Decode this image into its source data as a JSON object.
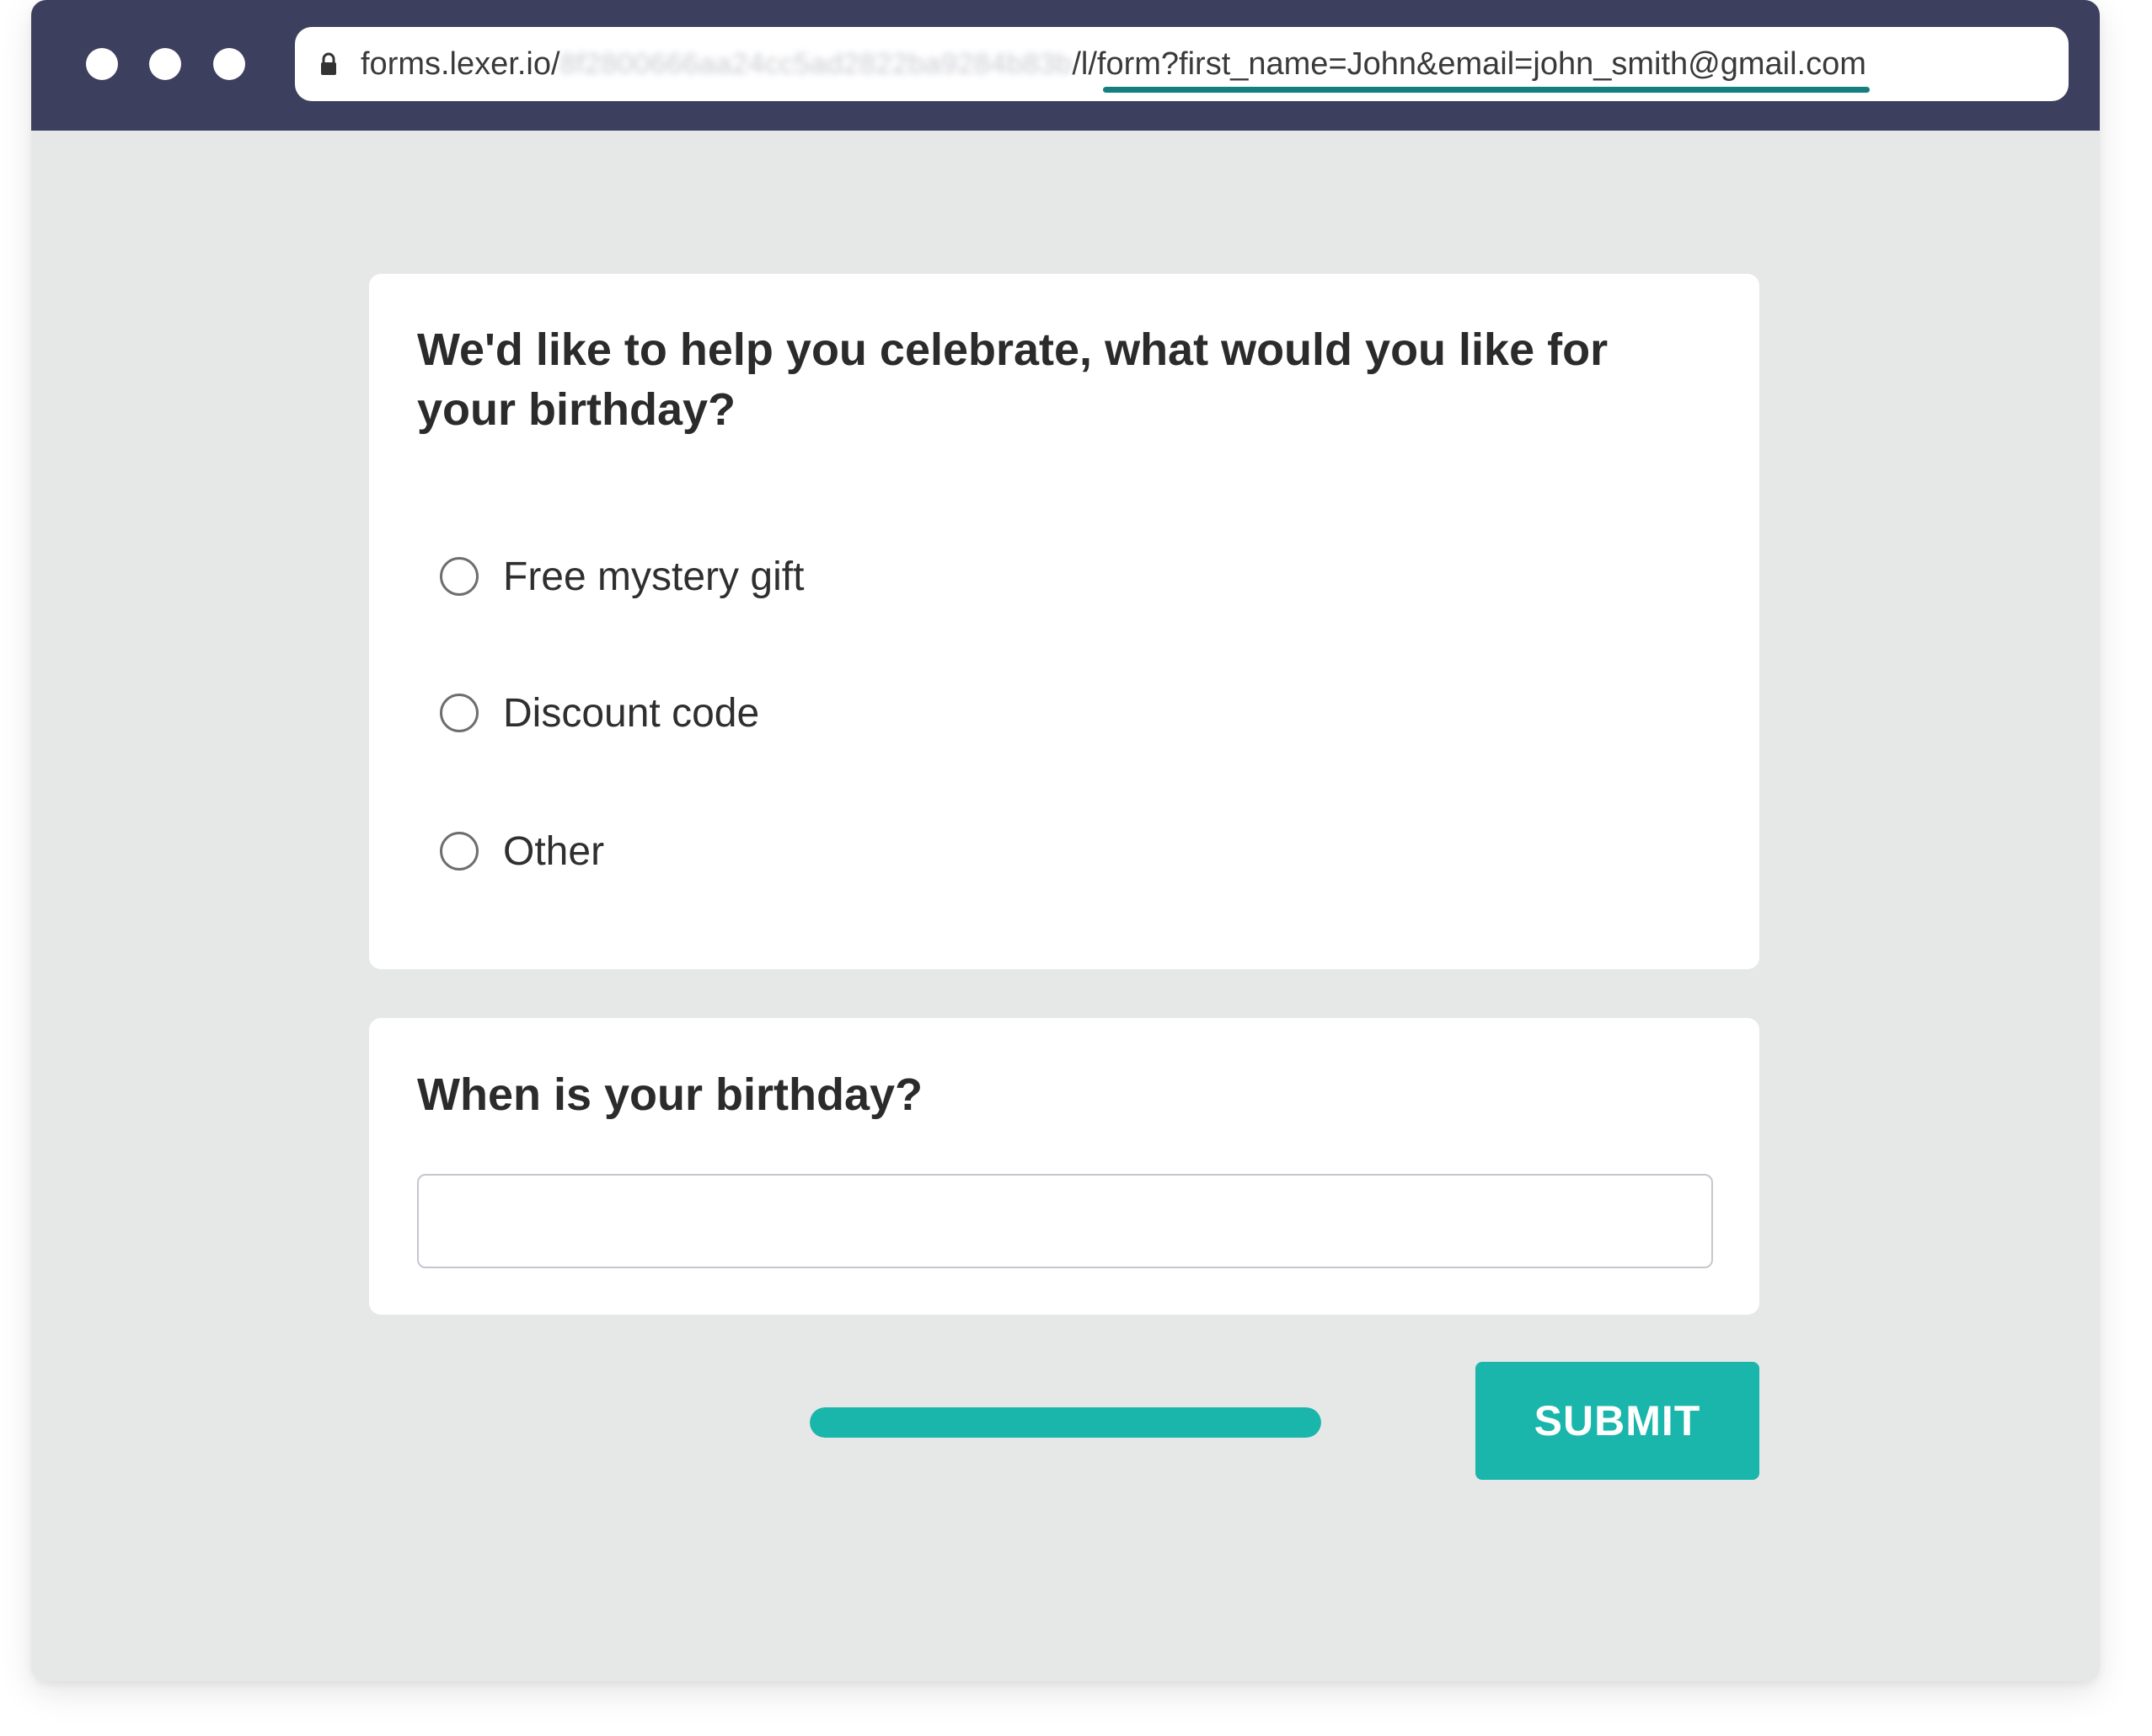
{
  "browser": {
    "url_domain": "forms.lexer.io/",
    "url_redacted": "8f2800666aa24cc5ad2822ba9284b83b",
    "url_path": "/l/",
    "url_query": "form?first_name=John&email=john_smith@gmail.com",
    "icons": [
      "window-dot",
      "lock-icon"
    ]
  },
  "form": {
    "question_1": {
      "text": "We'd like to help you celebrate, what would you like for your birthday?",
      "options": [
        "Free mystery gift",
        "Discount code",
        "Other"
      ]
    },
    "question_2": {
      "text": "When is your birthday?",
      "input_value": "",
      "input_placeholder": ""
    },
    "progress": 1.0,
    "submit_label": "SUBMIT"
  },
  "colors": {
    "titlebar": "#3d3f5f",
    "accent": "#1ab5ab",
    "url_underline": "#157f7f",
    "page_background": "#e6e8e8"
  }
}
